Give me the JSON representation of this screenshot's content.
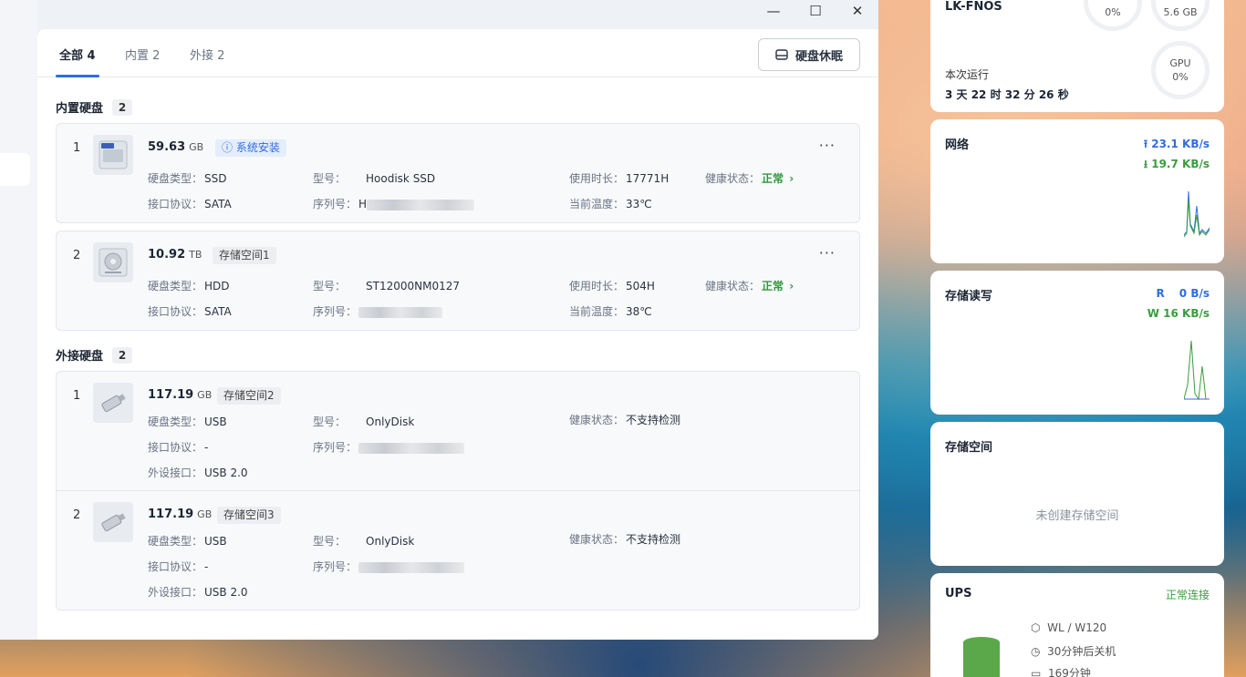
{
  "window": {
    "controls": [
      "—",
      "☐",
      "✕"
    ]
  },
  "tabs": [
    {
      "label": "全部 4"
    },
    {
      "label": "内置 2"
    },
    {
      "label": "外接 2"
    }
  ],
  "sleep_button": {
    "label": "硬盘休眠",
    "icon": "disk-sleep-icon"
  },
  "internal": {
    "title": "内置硬盘",
    "count": "2",
    "disks": [
      {
        "index": "1",
        "size": "59.63",
        "unit": "GB",
        "tag": "系统安装",
        "icon": "ssd-icon",
        "type_label": "硬盘类型：",
        "type": "SSD",
        "model_label": "型号：",
        "model": "Hoodisk SSD",
        "uptime_label": "使用时长：",
        "uptime": "17771H",
        "health_label": "健康状态：",
        "health": "正常",
        "iface_label": "接口协议：",
        "iface": "SATA",
        "serial_label": "序列号：",
        "serial": "H",
        "temp_label": "当前温度：",
        "temp": "33℃"
      },
      {
        "index": "2",
        "size": "10.92",
        "unit": "TB",
        "tag": "存储空间1",
        "icon": "hdd-icon",
        "type_label": "硬盘类型：",
        "type": "HDD",
        "model_label": "型号：",
        "model": "ST12000NM0127",
        "uptime_label": "使用时长：",
        "uptime": "504H",
        "health_label": "健康状态：",
        "health": "正常",
        "iface_label": "接口协议：",
        "iface": "SATA",
        "serial_label": "序列号：",
        "serial": "",
        "temp_label": "当前温度：",
        "temp": "38℃"
      }
    ]
  },
  "external": {
    "title": "外接硬盘",
    "count": "2",
    "disks": [
      {
        "index": "1",
        "size": "117.19",
        "unit": "GB",
        "tag": "存储空间2",
        "icon": "usb-drive-icon",
        "type_label": "硬盘类型：",
        "type": "USB",
        "model_label": "型号：",
        "model": "OnlyDisk",
        "health_label": "健康状态：",
        "health": "不支持检测",
        "iface_label": "接口协议：",
        "iface": "-",
        "serial_label": "序列号：",
        "serial": "",
        "port_label": "外设接口：",
        "port": "USB 2.0"
      },
      {
        "index": "2",
        "size": "117.19",
        "unit": "GB",
        "tag": "存储空间3",
        "icon": "usb-drive-icon",
        "type_label": "硬盘类型：",
        "type": "USB",
        "model_label": "型号：",
        "model": "OnlyDisk",
        "health_label": "健康状态：",
        "health": "不支持检测",
        "iface_label": "接口协议：",
        "iface": "-",
        "serial_label": "序列号：",
        "serial": "",
        "port_label": "外设接口：",
        "port": "USB 2.0"
      }
    ]
  },
  "widgets": {
    "system": {
      "hostname": "LK-FNOS",
      "cpu_value": "0%",
      "mem_value": "5.6 GB",
      "gpu_label": "GPU",
      "gpu_value": "0%",
      "uptime_label": "本次运行",
      "uptime": "3 天 22 时 32 分 26 秒"
    },
    "network": {
      "title": "网络",
      "up": "23.1 KB/s",
      "down": "19.7 KB/s"
    },
    "storage_io": {
      "title": "存储读写",
      "read_label": "R",
      "read": "0 B/s",
      "write": "W 16 KB/s"
    },
    "storage_space": {
      "title": "存储空间",
      "empty": "未创建存储空间"
    },
    "ups": {
      "title": "UPS",
      "status": "正常连接",
      "model": "WL / W120",
      "shutdown": "30分钟后关机",
      "runtime": "169分钟"
    }
  },
  "colors": {
    "accent": "#2f6de0",
    "ok": "#2f9a3a"
  }
}
